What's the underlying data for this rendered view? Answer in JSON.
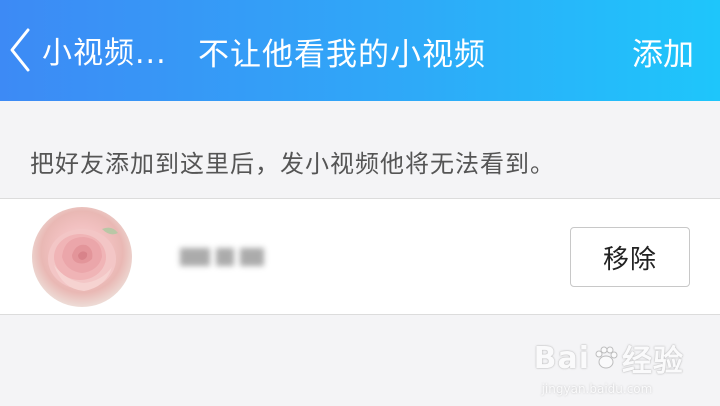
{
  "header": {
    "back_label": "小视频...",
    "title": "不让他看我的小视频",
    "add_label": "添加"
  },
  "hint": "把好友添加到这里后，发小视频他将无法看到。",
  "list": {
    "items": [
      {
        "avatar": "rose-avatar",
        "name": "",
        "remove_label": "移除"
      }
    ]
  },
  "watermark": {
    "logo_text_left": "Bai",
    "logo_text_right": "经验",
    "url": "jingyan.baidu.com"
  },
  "colors": {
    "header_start": "#3d8af5",
    "header_end": "#1ec6fb",
    "background": "#f4f4f6"
  }
}
